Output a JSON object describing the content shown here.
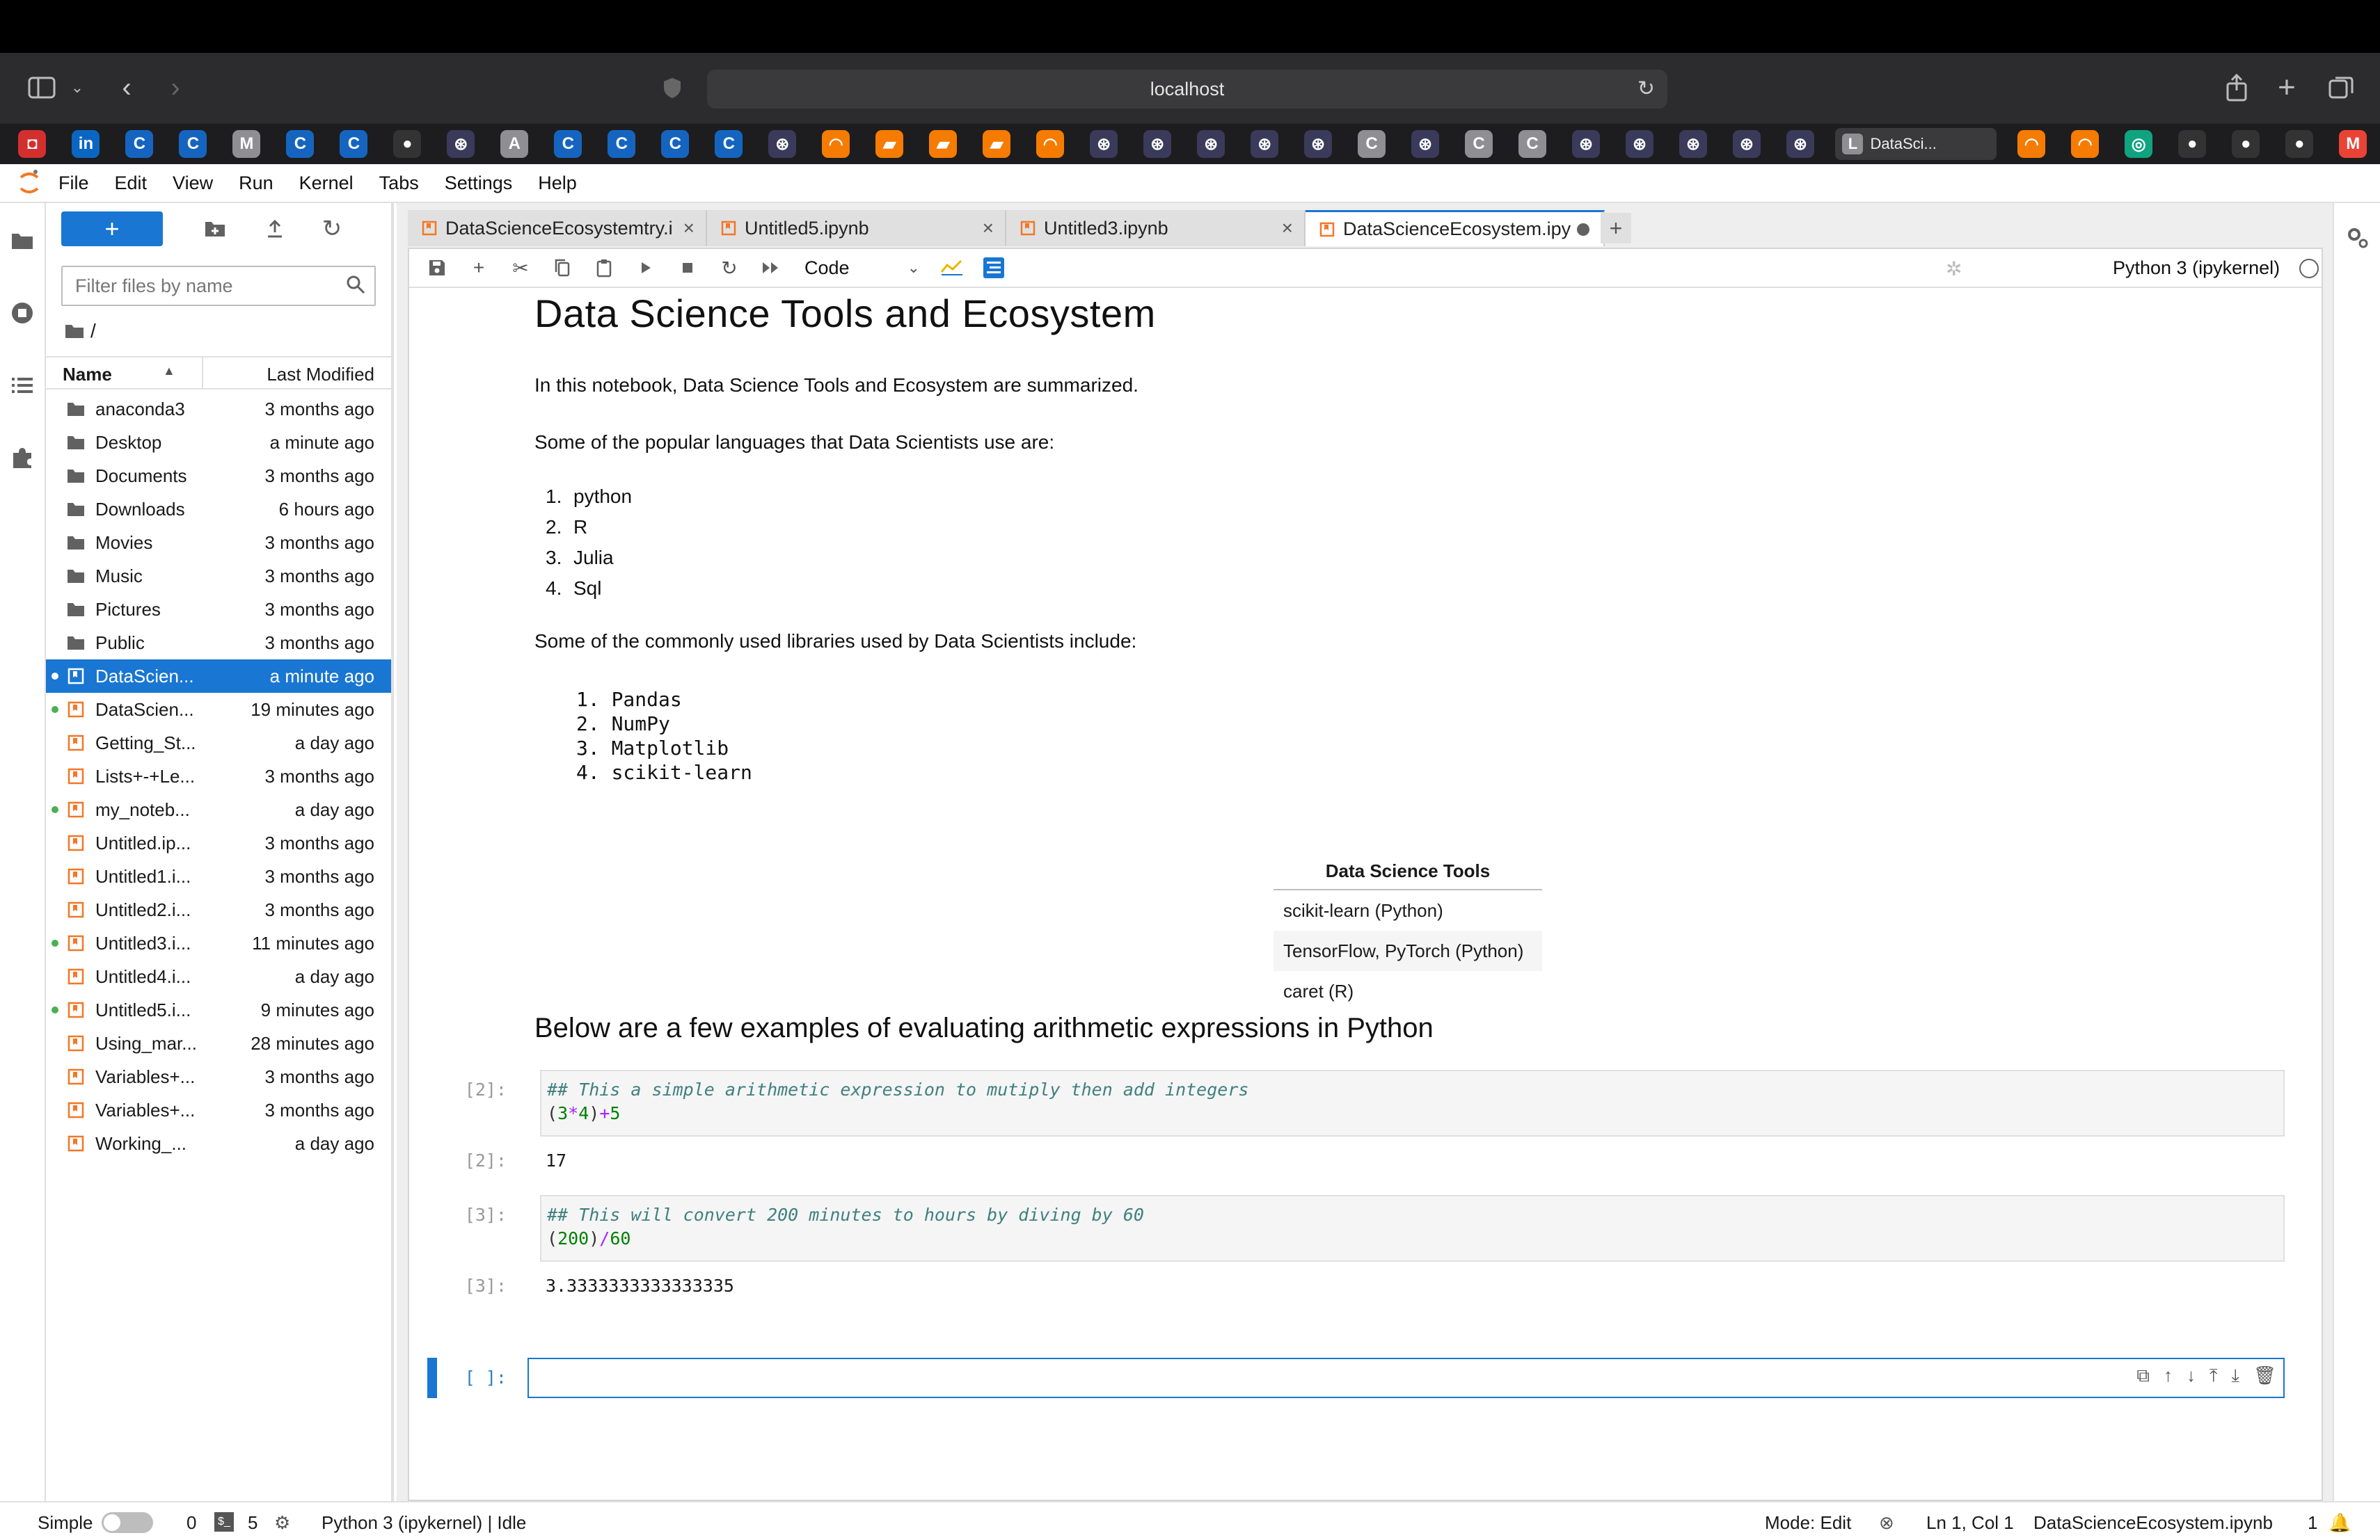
{
  "browser": {
    "url": "localhost",
    "bookmarks": [
      {
        "glyph": "◘",
        "color": "#d32f2f"
      },
      {
        "glyph": "in",
        "color": "#0a66c2"
      },
      {
        "glyph": "C",
        "color": "#1565c0"
      },
      {
        "glyph": "C",
        "color": "#1565c0"
      },
      {
        "glyph": "M",
        "color": "#8e8e93"
      },
      {
        "glyph": "C",
        "color": "#1565c0"
      },
      {
        "glyph": "C",
        "color": "#1565c0"
      },
      {
        "glyph": "●",
        "color": "#333"
      },
      {
        "glyph": "⊛",
        "color": "#3a3a5a"
      },
      {
        "glyph": "A",
        "color": "#8e8e93"
      },
      {
        "glyph": "C",
        "color": "#1565c0"
      },
      {
        "glyph": "C",
        "color": "#1565c0"
      },
      {
        "glyph": "C",
        "color": "#1565c0"
      },
      {
        "glyph": "C",
        "color": "#1565c0"
      },
      {
        "glyph": "⊛",
        "color": "#3a3a5a"
      },
      {
        "glyph": "◠",
        "color": "#f57c00"
      },
      {
        "glyph": "▰",
        "color": "#f57c00"
      },
      {
        "glyph": "▰",
        "color": "#f57c00"
      },
      {
        "glyph": "▰",
        "color": "#f57c00"
      },
      {
        "glyph": "◠",
        "color": "#f57c00"
      },
      {
        "glyph": "⊛",
        "color": "#3a3a5a"
      },
      {
        "glyph": "⊛",
        "color": "#3a3a5a"
      },
      {
        "glyph": "⊛",
        "color": "#3a3a5a"
      },
      {
        "glyph": "⊛",
        "color": "#3a3a5a"
      },
      {
        "glyph": "⊛",
        "color": "#3a3a5a"
      },
      {
        "glyph": "C",
        "color": "#8e8e93"
      },
      {
        "glyph": "⊛",
        "color": "#3a3a5a"
      },
      {
        "glyph": "C",
        "color": "#8e8e93"
      },
      {
        "glyph": "C",
        "color": "#8e8e93"
      },
      {
        "glyph": "⊛",
        "color": "#3a3a5a"
      },
      {
        "glyph": "⊛",
        "color": "#3a3a5a"
      },
      {
        "glyph": "⊛",
        "color": "#3a3a5a"
      },
      {
        "glyph": "⊛",
        "color": "#3a3a5a"
      },
      {
        "glyph": "⊛",
        "color": "#3a3a5a"
      }
    ],
    "bookmarks_right": [
      {
        "glyph": "◠",
        "color": "#f57c00"
      },
      {
        "glyph": "◠",
        "color": "#f57c00"
      },
      {
        "glyph": "◎",
        "color": "#10a37f"
      },
      {
        "glyph": "●",
        "color": "#333"
      },
      {
        "glyph": "●",
        "color": "#333"
      },
      {
        "glyph": "●",
        "color": "#333"
      },
      {
        "glyph": "M",
        "color": "#ea4335"
      }
    ],
    "active_tab_label": "DataSci..."
  },
  "menu": [
    "File",
    "Edit",
    "View",
    "Run",
    "Kernel",
    "Tabs",
    "Settings",
    "Help"
  ],
  "filebrowser": {
    "filter_placeholder": "Filter files by name",
    "path": "/",
    "col_name": "Name",
    "col_modified": "Last Modified",
    "rows": [
      {
        "name": "anaconda3",
        "modified": "3 months ago",
        "type": "folder",
        "running": false,
        "selected": false
      },
      {
        "name": "Desktop",
        "modified": "a minute ago",
        "type": "folder",
        "running": false,
        "selected": false
      },
      {
        "name": "Documents",
        "modified": "3 months ago",
        "type": "folder",
        "running": false,
        "selected": false
      },
      {
        "name": "Downloads",
        "modified": "6 hours ago",
        "type": "folder",
        "running": false,
        "selected": false
      },
      {
        "name": "Movies",
        "modified": "3 months ago",
        "type": "folder",
        "running": false,
        "selected": false
      },
      {
        "name": "Music",
        "modified": "3 months ago",
        "type": "folder",
        "running": false,
        "selected": false
      },
      {
        "name": "Pictures",
        "modified": "3 months ago",
        "type": "folder",
        "running": false,
        "selected": false
      },
      {
        "name": "Public",
        "modified": "3 months ago",
        "type": "folder",
        "running": false,
        "selected": false
      },
      {
        "name": "DataScien...",
        "modified": "a minute ago",
        "type": "notebook",
        "running": true,
        "selected": true
      },
      {
        "name": "DataScien...",
        "modified": "19 minutes ago",
        "type": "notebook",
        "running": true,
        "selected": false
      },
      {
        "name": "Getting_St...",
        "modified": "a day ago",
        "type": "notebook",
        "running": false,
        "selected": false
      },
      {
        "name": "Lists+-+Le...",
        "modified": "3 months ago",
        "type": "notebook",
        "running": false,
        "selected": false
      },
      {
        "name": "my_noteb...",
        "modified": "a day ago",
        "type": "notebook",
        "running": true,
        "selected": false
      },
      {
        "name": "Untitled.ip...",
        "modified": "3 months ago",
        "type": "notebook",
        "running": false,
        "selected": false
      },
      {
        "name": "Untitled1.i...",
        "modified": "3 months ago",
        "type": "notebook",
        "running": false,
        "selected": false
      },
      {
        "name": "Untitled2.i...",
        "modified": "3 months ago",
        "type": "notebook",
        "running": false,
        "selected": false
      },
      {
        "name": "Untitled3.i...",
        "modified": "11 minutes ago",
        "type": "notebook",
        "running": true,
        "selected": false
      },
      {
        "name": "Untitled4.i...",
        "modified": "a day ago",
        "type": "notebook",
        "running": false,
        "selected": false
      },
      {
        "name": "Untitled5.i...",
        "modified": "9 minutes ago",
        "type": "notebook",
        "running": true,
        "selected": false
      },
      {
        "name": "Using_mar...",
        "modified": "28 minutes ago",
        "type": "notebook",
        "running": false,
        "selected": false
      },
      {
        "name": "Variables+...",
        "modified": "3 months ago",
        "type": "notebook",
        "running": false,
        "selected": false
      },
      {
        "name": "Variables+...",
        "modified": "3 months ago",
        "type": "notebook",
        "running": false,
        "selected": false
      },
      {
        "name": "Working_...",
        "modified": "a day ago",
        "type": "notebook",
        "running": false,
        "selected": false
      }
    ]
  },
  "tabs": [
    {
      "label": "DataScienceEcosystemtry.i",
      "active": false
    },
    {
      "label": "Untitled5.ipynb",
      "active": false
    },
    {
      "label": "Untitled3.ipynb",
      "active": false
    },
    {
      "label": "DataScienceEcosystem.ipy",
      "active": true
    }
  ],
  "toolbar": {
    "cell_type": "Code",
    "kernel": "Python 3 (ipykernel)"
  },
  "notebook": {
    "title": "Data Science Tools and Ecosystem",
    "intro": "In this notebook, Data Science Tools and Ecosystem are summarized.",
    "languages_intro": "Some of the popular languages that Data Scientists use are:",
    "languages": [
      "python",
      "R",
      "Julia",
      "Sql"
    ],
    "libraries_intro": "Some of the commonly used libraries used by Data Scientists include:",
    "libraries": [
      "1. Pandas",
      "2. NumPy",
      "3. Matplotlib",
      "4. scikit-learn"
    ],
    "tools_header": "Data Science Tools",
    "tools": [
      "scikit-learn (Python)",
      "TensorFlow, PyTorch (Python)",
      "caret (R)"
    ],
    "examples_heading": "Below are a few examples of evaluating arithmetic expressions in Python",
    "cells": [
      {
        "prompt": "[2]:",
        "comment": "## This a simple arithmetic expression to mutiply then add integers",
        "out_prompt": "[2]:",
        "output": "17"
      },
      {
        "prompt": "[3]:",
        "comment": "## This will convert 200 minutes to hours by diving by 60",
        "out_prompt": "[3]:",
        "output": "3.3333333333333335"
      }
    ],
    "empty_prompt": "[ ]:"
  },
  "status": {
    "simple_label": "Simple",
    "terminals": "0",
    "kernels": "5",
    "kernel_status": "Python 3 (ipykernel) | Idle",
    "mode": "Mode: Edit",
    "position": "Ln 1, Col 1",
    "filename": "DataScienceEcosystem.ipynb",
    "notifications": "1"
  }
}
